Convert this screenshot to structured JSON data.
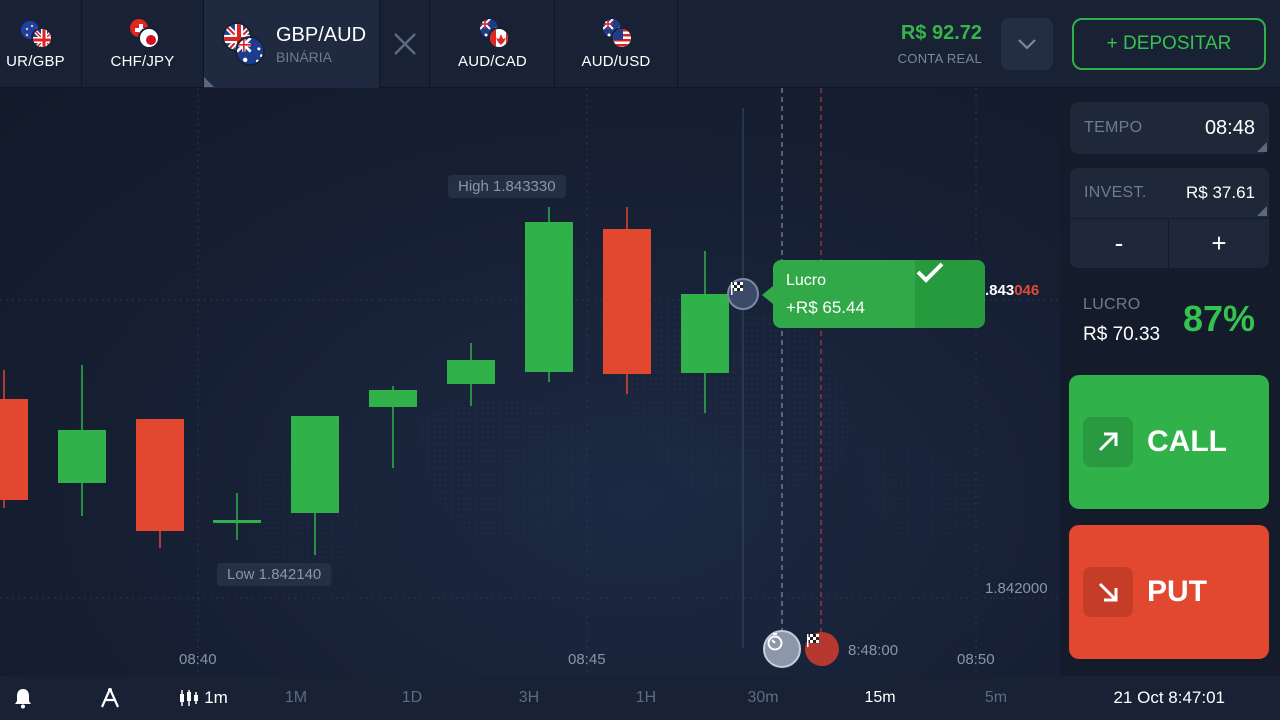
{
  "tabs": [
    {
      "label": "UR/GBP",
      "flags": [
        "eu-flag-icon",
        "uk-flag-icon"
      ]
    },
    {
      "label": "CHF/JPY",
      "flags": [
        "ch-flag-icon",
        "jp-flag-icon"
      ]
    },
    {
      "label": "GBP/AUD",
      "sub": "BINÁRIA",
      "flags": [
        "uk-flag-icon",
        "au-flag-icon"
      ],
      "active": true
    },
    {
      "label": "AUD/CAD",
      "flags": [
        "au-flag-icon",
        "ca-flag-icon"
      ]
    },
    {
      "label": "AUD/USD",
      "flags": [
        "au-flag-icon",
        "us-flag-icon"
      ]
    }
  ],
  "account": {
    "balance": "R$ 92.72",
    "type": "CONTA REAL",
    "deposit_label": "+ DEPOSITAR"
  },
  "chart": {
    "high_label": "High 1.843330",
    "low_label": "Low 1.842140",
    "price_level": "1.842000",
    "current_price_main": ".843",
    "current_price_tail": "046",
    "time_labels": [
      "08:40",
      "08:45",
      "08:50"
    ],
    "expiry_time": "8:48:00",
    "lucro_title": "Lucro",
    "lucro_value": "+R$ 65.44",
    "candles": [
      {
        "dir": "down"
      },
      {
        "dir": "up"
      },
      {
        "dir": "down"
      },
      {
        "dir": "doji"
      },
      {
        "dir": "up"
      },
      {
        "dir": "up"
      },
      {
        "dir": "up"
      },
      {
        "dir": "up"
      },
      {
        "dir": "down"
      },
      {
        "dir": "up"
      }
    ]
  },
  "panel": {
    "time_label": "TEMPO",
    "time_value": "08:48",
    "invest_label": "INVEST.",
    "invest_value": "R$ 37.61",
    "minus_label": "-",
    "plus_label": "+",
    "profit_label": "LUCRO",
    "profit_value": "R$ 70.33",
    "profit_pct": "87%",
    "call_label": "CALL",
    "put_label": "PUT"
  },
  "bottom": {
    "candle_interval": "1m",
    "timeframes": [
      "1M",
      "1D",
      "3H",
      "1H",
      "30m",
      "15m",
      "5m"
    ],
    "selected_timeframe": "15m",
    "datetime": "21 Oct 8:47:01"
  },
  "colors": {
    "green": "#30b14a",
    "red": "#e1482f",
    "background": "#141c2c"
  }
}
